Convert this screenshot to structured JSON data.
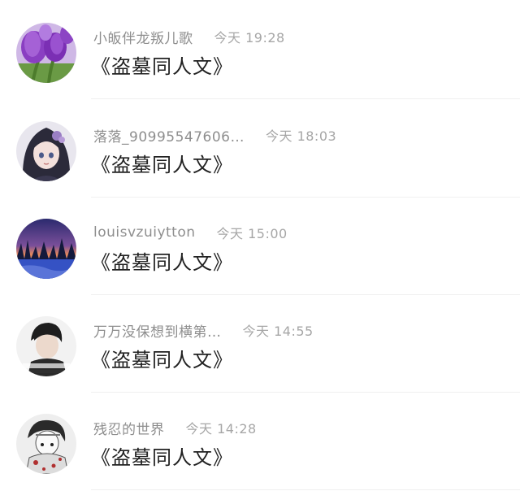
{
  "comments": [
    {
      "username": "小皈伴龙叛儿歌",
      "time": "今天 19:28",
      "text": "《盗墓同人文》",
      "avatar": "purple-tulips-avatar"
    },
    {
      "username": "落落_90995547606…",
      "time": "今天 18:03",
      "text": "《盗墓同人文》",
      "avatar": "anime-girl-avatar"
    },
    {
      "username": "louisvzuiytton",
      "time": "今天 15:00",
      "text": "《盗墓同人文》",
      "avatar": "snowy-forest-avatar"
    },
    {
      "username": "万万没保想到横第…",
      "time": "今天 14:55",
      "text": "《盗墓同人文》",
      "avatar": "boy-photo-avatar"
    },
    {
      "username": "残忍的世界",
      "time": "今天 14:28",
      "text": "《盗墓同人文》",
      "avatar": "manga-character-avatar"
    }
  ],
  "colors": {
    "username": "#8e8e8e",
    "time": "#a6a6a6",
    "text": "#222222",
    "divider": "#f0f0f0"
  }
}
